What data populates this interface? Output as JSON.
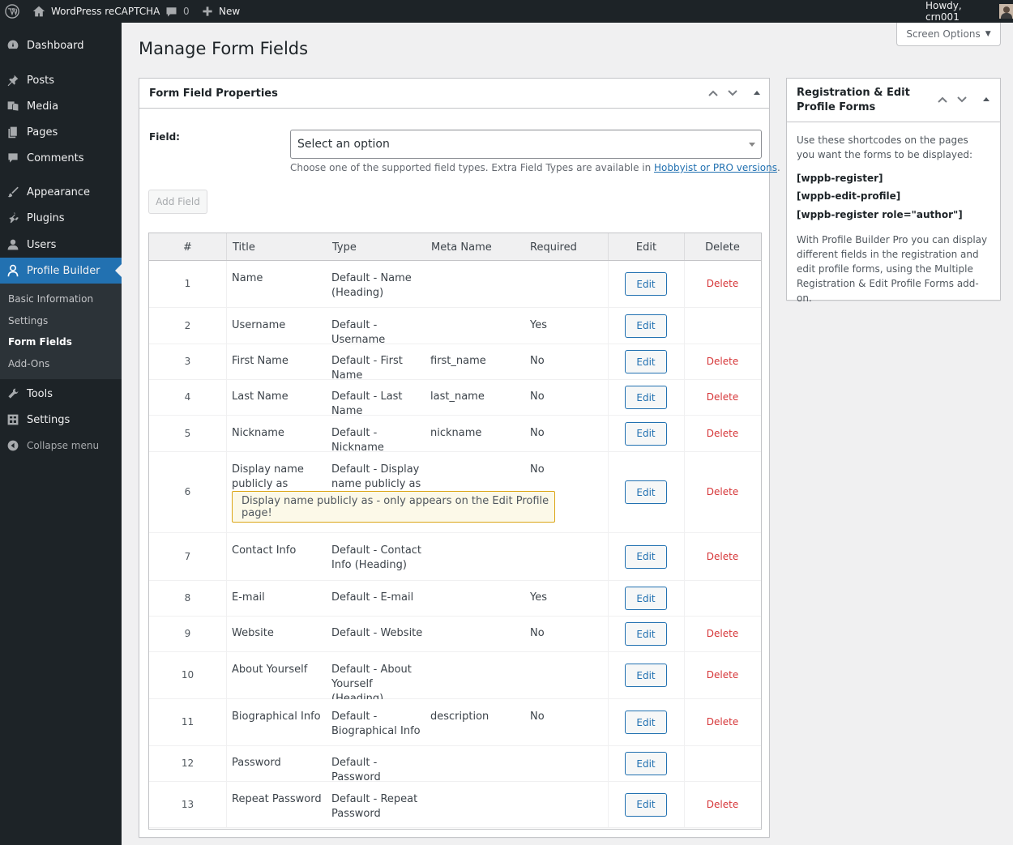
{
  "adminbar": {
    "site_name": "WordPress reCAPTCHA",
    "comments_count": "0",
    "new_label": "New",
    "howdy": "Howdy, crn001"
  },
  "sidebar": {
    "items": [
      {
        "label": "Dashboard",
        "icon": "dashboard-icon"
      },
      {
        "label": "Posts",
        "icon": "pin-icon"
      },
      {
        "label": "Media",
        "icon": "media-icon"
      },
      {
        "label": "Pages",
        "icon": "pages-icon"
      },
      {
        "label": "Comments",
        "icon": "comment-icon"
      },
      {
        "label": "Appearance",
        "icon": "brush-icon"
      },
      {
        "label": "Plugins",
        "icon": "plugin-icon"
      },
      {
        "label": "Users",
        "icon": "user-icon"
      },
      {
        "label": "Profile Builder",
        "icon": "profile-icon"
      },
      {
        "label": "Tools",
        "icon": "wrench-icon"
      },
      {
        "label": "Settings",
        "icon": "settings-icon"
      },
      {
        "label": "Collapse menu",
        "icon": "collapse-icon"
      }
    ],
    "submenu": [
      "Basic Information",
      "Settings",
      "Form Fields",
      "Add-Ons"
    ]
  },
  "page": {
    "title": "Manage Form Fields",
    "screen_options": "Screen Options"
  },
  "form_box": {
    "title": "Form Field Properties",
    "field_label": "Field:",
    "select_value": "Select an option",
    "desc_text": "Choose one of the supported field types. Extra Field Types are available in ",
    "desc_link": "Hobbyist or PRO versions",
    "desc_end": ".",
    "add_button": "Add Field"
  },
  "table": {
    "headers": [
      "#",
      "Title",
      "Type",
      "Meta Name",
      "Required",
      "Edit",
      "Delete"
    ],
    "edit_label": "Edit",
    "delete_label": "Delete",
    "note": "Display name publicly as - only appears on the Edit Profile page!",
    "rows": [
      {
        "num": "1",
        "title": "Name",
        "type": "Default - Name (Heading)",
        "meta": "",
        "required": "",
        "delete": true
      },
      {
        "num": "2",
        "title": "Username",
        "type": "Default - Username",
        "meta": "",
        "required": "Yes",
        "delete": false
      },
      {
        "num": "3",
        "title": "First Name",
        "type": "Default - First Name",
        "meta": "first_name",
        "required": "No",
        "delete": true
      },
      {
        "num": "4",
        "title": "Last Name",
        "type": "Default - Last Name",
        "meta": "last_name",
        "required": "No",
        "delete": true
      },
      {
        "num": "5",
        "title": "Nickname",
        "type": "Default - Nickname",
        "meta": "nickname",
        "required": "No",
        "delete": true
      },
      {
        "num": "6",
        "title": "Display name publicly as",
        "type": "Default - Display name publicly as",
        "meta": "",
        "required": "No",
        "delete": true
      },
      {
        "num": "7",
        "title": "Contact Info",
        "type": "Default - Contact Info (Heading)",
        "meta": "",
        "required": "",
        "delete": true
      },
      {
        "num": "8",
        "title": "E-mail",
        "type": "Default - E-mail",
        "meta": "",
        "required": "Yes",
        "delete": false
      },
      {
        "num": "9",
        "title": "Website",
        "type": "Default - Website",
        "meta": "",
        "required": "No",
        "delete": true
      },
      {
        "num": "10",
        "title": "About Yourself",
        "type": "Default - About Yourself (Heading)",
        "meta": "",
        "required": "",
        "delete": true
      },
      {
        "num": "11",
        "title": "Biographical Info",
        "type": "Default - Biographical Info",
        "meta": "description",
        "required": "No",
        "delete": true
      },
      {
        "num": "12",
        "title": "Password",
        "type": "Default - Password",
        "meta": "",
        "required": "",
        "delete": false
      },
      {
        "num": "13",
        "title": "Repeat Password",
        "type": "Default - Repeat Password",
        "meta": "",
        "required": "",
        "delete": true
      }
    ]
  },
  "side_box": {
    "title": "Registration & Edit Profile Forms",
    "desc": "Use these shortcodes on the pages you want the forms to be displayed:",
    "shortcodes": [
      "[wppb-register]",
      "[wppb-edit-profile]",
      "[wppb-register role=\"author\"]"
    ],
    "pro_text": "With Profile Builder Pro you can display different fields in the registration and edit profile forms, using the Multiple Registration & Edit Profile Forms add-on."
  },
  "colors": {
    "accent": "#2271b1",
    "sidebar": "#1d2327",
    "delete": "#d63638"
  }
}
